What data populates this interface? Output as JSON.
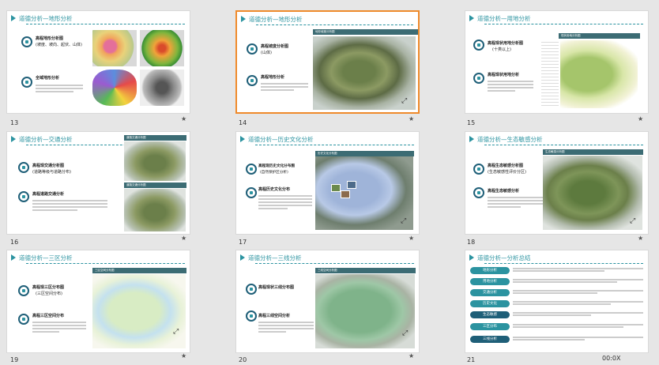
{
  "slides": [
    {
      "num": "13",
      "title": "道德分析—地形分析",
      "items": [
        {
          "label": "高程地形分析图",
          "sub": "(坡度、坡向、起伏、山体)"
        },
        {
          "label": "全域地形分析"
        }
      ]
    },
    {
      "num": "14",
      "title": "道德分析—地形分析",
      "items": [
        {
          "label": "高程坡度分析图",
          "sub": "(山体)"
        },
        {
          "label": "高程地形分析"
        }
      ]
    },
    {
      "num": "15",
      "title": "道德分析—用地分析",
      "items": [
        {
          "label": "高程现状用地分析图",
          "sub": "(十类以上)"
        },
        {
          "label": "高程现状用地分析"
        }
      ]
    },
    {
      "num": "16",
      "title": "道德分析—交通分析",
      "items": [
        {
          "label": "高程现交通分析图",
          "sub": "(道路等级与道路分布)"
        },
        {
          "label": "高程道路交通分析"
        }
      ]
    },
    {
      "num": "17",
      "title": "道德分析—历史文化分析",
      "items": [
        {
          "label": "高程现历史文化分布图",
          "sub": "(自然保护区分析)"
        },
        {
          "label": "高程历史文化分布"
        }
      ]
    },
    {
      "num": "18",
      "title": "道德分析—生态敏感分析",
      "items": [
        {
          "label": "高程生态敏感分析图",
          "sub": "(生态敏感性评价分区)"
        },
        {
          "label": "高程生态敏感分析"
        }
      ]
    },
    {
      "num": "19",
      "title": "道德分析—三区分析",
      "items": [
        {
          "label": "高程现三区分布图",
          "sub": "(三区空间分布)"
        },
        {
          "label": "高程三区空间分布"
        }
      ]
    },
    {
      "num": "20",
      "title": "道德分析—三线分析",
      "items": [
        {
          "label": "高程现状三线分布图"
        },
        {
          "label": "高程三线空间分析"
        }
      ]
    },
    {
      "num": "21",
      "title": "道德分析—分析总结",
      "pills": [
        "地形分析",
        "用地分析",
        "交通分析",
        "历史文化",
        "生态敏感",
        "三区分布",
        "三线分析"
      ]
    }
  ],
  "footer": {
    "page_indicator": "00:0X"
  },
  "colors": {
    "accent": "#2b93a0",
    "selected": "#ef8a2b",
    "dark": "#1f5f78"
  }
}
